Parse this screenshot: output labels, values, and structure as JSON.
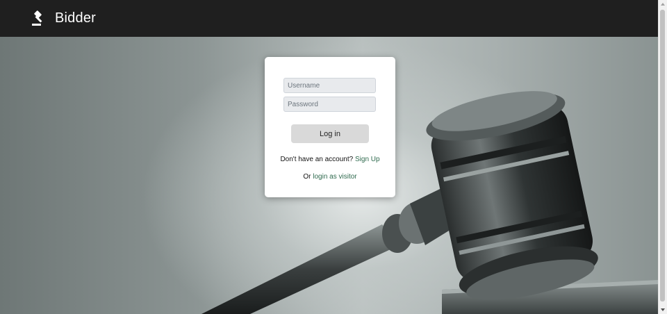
{
  "navbar": {
    "brand_name": "Bidder",
    "brand_icon": "gavel-icon",
    "background": "#1f1f1f"
  },
  "login": {
    "username_placeholder": "Username",
    "password_placeholder": "Password",
    "login_button": "Log in",
    "signup_prompt": "Don't have an account?",
    "signup_link": "Sign Up",
    "visitor_prefix": "Or",
    "visitor_link": "login as visitor",
    "link_color": "#2f6a4e"
  },
  "hero": {
    "image": "judge-gavel-image"
  }
}
